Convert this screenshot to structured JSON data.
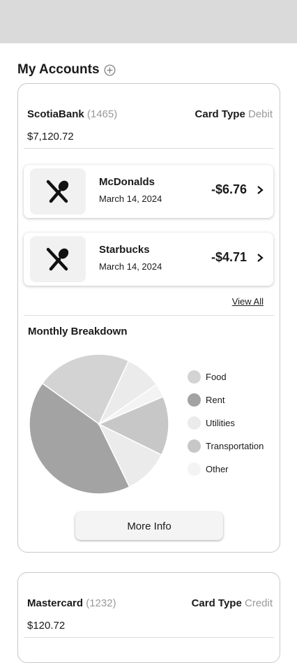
{
  "header": {
    "title": "My Accounts"
  },
  "accounts": [
    {
      "bank": "ScotiaBank",
      "number": "(1465)",
      "card_type_label": "Card Type",
      "card_type": "Debit",
      "balance": "$7,120.72",
      "transactions": [
        {
          "merchant": "McDonalds",
          "date": "March 14, 2024",
          "amount": "-$6.76",
          "icon": "fork-spoon-icon"
        },
        {
          "merchant": "Starbucks",
          "date": "March 14, 2024",
          "amount": "-$4.71",
          "icon": "fork-spoon-icon"
        }
      ],
      "view_all": "View All",
      "breakdown_title": "Monthly Breakdown",
      "more_info": "More Info"
    },
    {
      "bank": "Mastercard",
      "number": "(1232)",
      "card_type_label": "Card Type",
      "card_type": "Credit",
      "balance": "$120.72"
    }
  ],
  "chart_data": {
    "type": "pie",
    "categories": [
      "Food",
      "Rent",
      "Utilities",
      "Transportation",
      "Other"
    ],
    "colors": [
      "#d3d3d3",
      "#a3a3a3",
      "#ebebeb",
      "#c7c7c7",
      "#f3f3f3"
    ],
    "slices": [
      {
        "category": "Food",
        "value": 21
      },
      {
        "category": "Rent",
        "value": 40
      },
      {
        "category": "Utilities",
        "value": 10
      },
      {
        "category": "Transportation",
        "value": 13
      },
      {
        "category": "Other",
        "value": 3
      },
      {
        "category": "Utilities",
        "value": 8
      }
    ]
  }
}
